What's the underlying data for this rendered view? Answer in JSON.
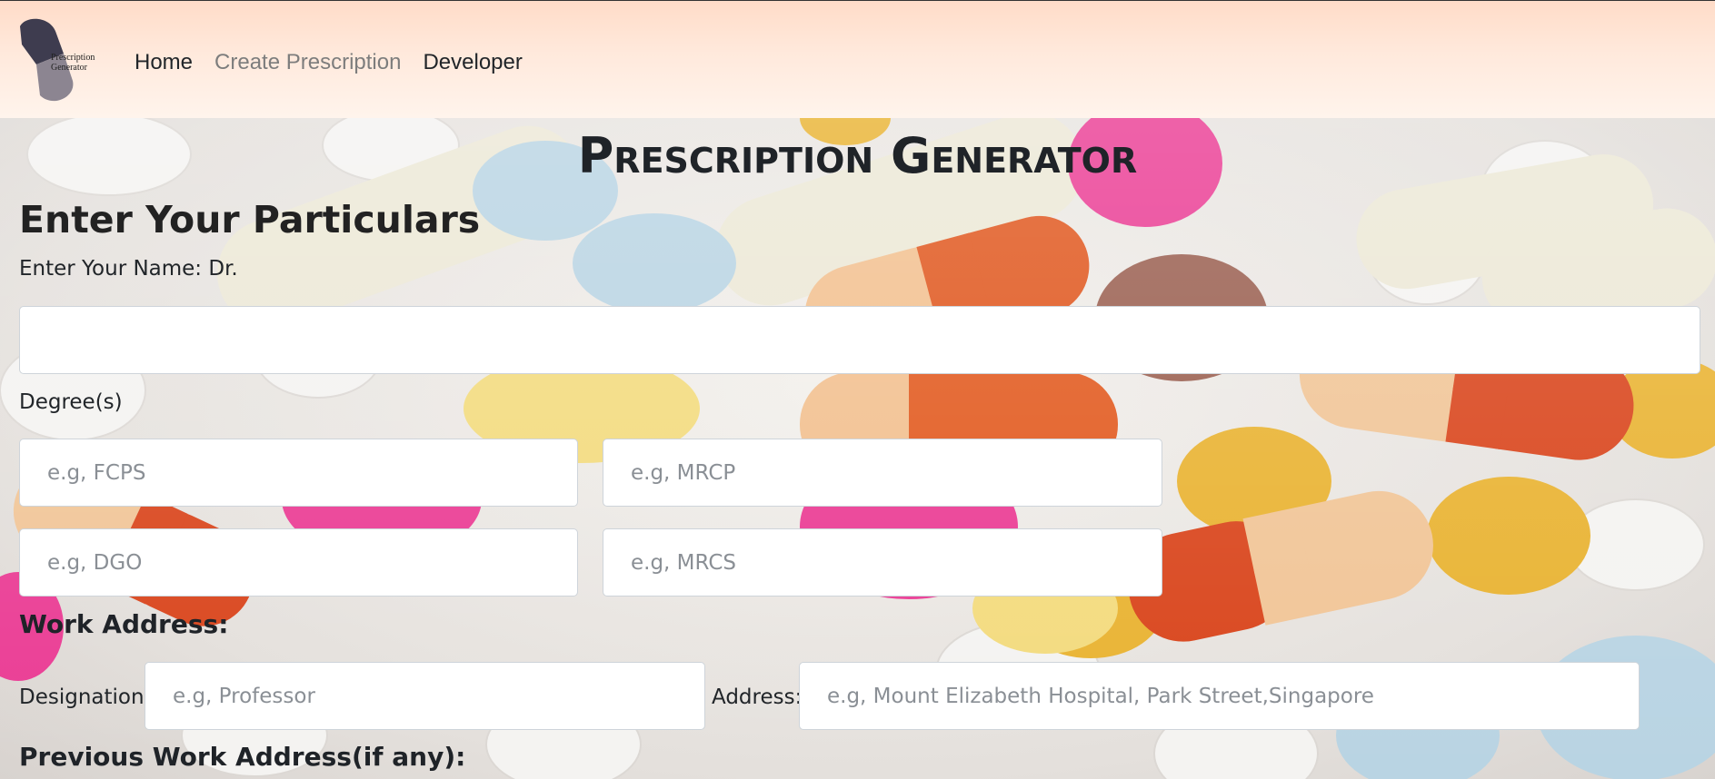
{
  "nav": {
    "logo_text_1": "Prescription",
    "logo_text_2": "Generator",
    "links": [
      "Home",
      "Create Prescription",
      "Developer"
    ]
  },
  "page": {
    "title": "Prescription Generator",
    "section_title": "Enter Your Particulars"
  },
  "form": {
    "name_label": "Enter Your Name: Dr.",
    "name_value": "",
    "degrees_label": "Degree(s)",
    "degree_placeholders": [
      "e.g, FCPS",
      "e.g, MRCP",
      "e.g, DGO",
      "e.g, MRCS"
    ],
    "work_address_heading": "Work Address:",
    "designation_label": "Designation:",
    "designation_placeholder": "e.g, Professor",
    "address_label": "Address:",
    "address_placeholder": "e.g, Mount Elizabeth Hospital, Park Street,Singapore",
    "previous_work_heading": "Previous Work Address(if any):"
  },
  "colors": {
    "navbar_gradient_start": "#ffdcc8",
    "navbar_gradient_end": "#fff4ec",
    "muted_link": "#7d7d7d"
  }
}
